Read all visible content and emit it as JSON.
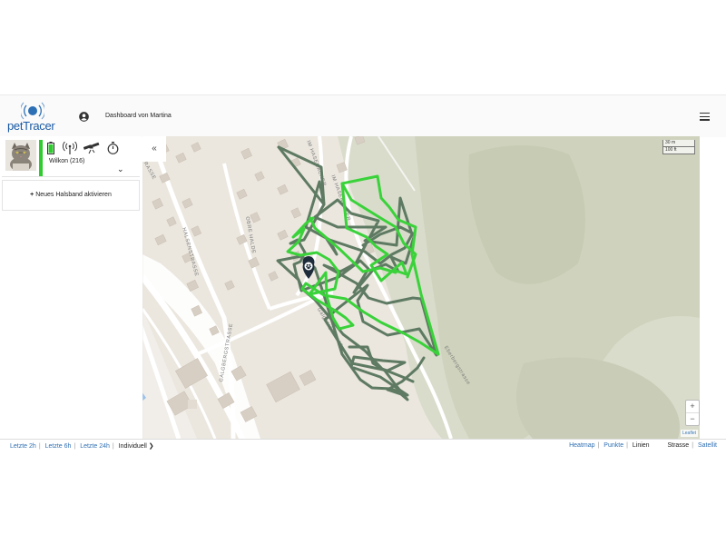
{
  "header": {
    "logo_text": "petTracer",
    "dashboard_title": "Dashboard von Martina"
  },
  "sidebar": {
    "pet": {
      "name": "Wilkon (216)",
      "status_color": "#2ecc2e"
    },
    "status_icons": [
      "battery-icon",
      "signal-icon",
      "satellite-icon",
      "stopwatch-icon"
    ],
    "add_collar_label": "Neues Halsband aktivieren",
    "collapse_label": "«"
  },
  "map": {
    "streets": [
      "IM HASENACKER",
      "IM HASENACKER",
      "OBRE HALDE",
      "HALSENSTRASSE",
      "GALGBERGSTRASSE",
      "HALSENSTRASSE",
      "Galgbergstrasse",
      "Eberbergstrasse",
      "47"
    ],
    "scale": [
      "30 m",
      "100 ft"
    ],
    "zoom_in": "+",
    "zoom_out": "−",
    "attribution": "Leaflet",
    "track_colors": {
      "dark": "#5e7a62",
      "bright": "#3ad23a",
      "marker": "#1d2b3a"
    }
  },
  "footer": {
    "time_ranges": [
      "Letzte 2h",
      "Letzte 6h",
      "Letzte 24h"
    ],
    "individual": "Individuell ❯",
    "display_modes": [
      "Heatmap",
      "Punkte"
    ],
    "lines_label": "Linien",
    "map_types_current": "Strasse",
    "map_types_other": "Satellit"
  }
}
